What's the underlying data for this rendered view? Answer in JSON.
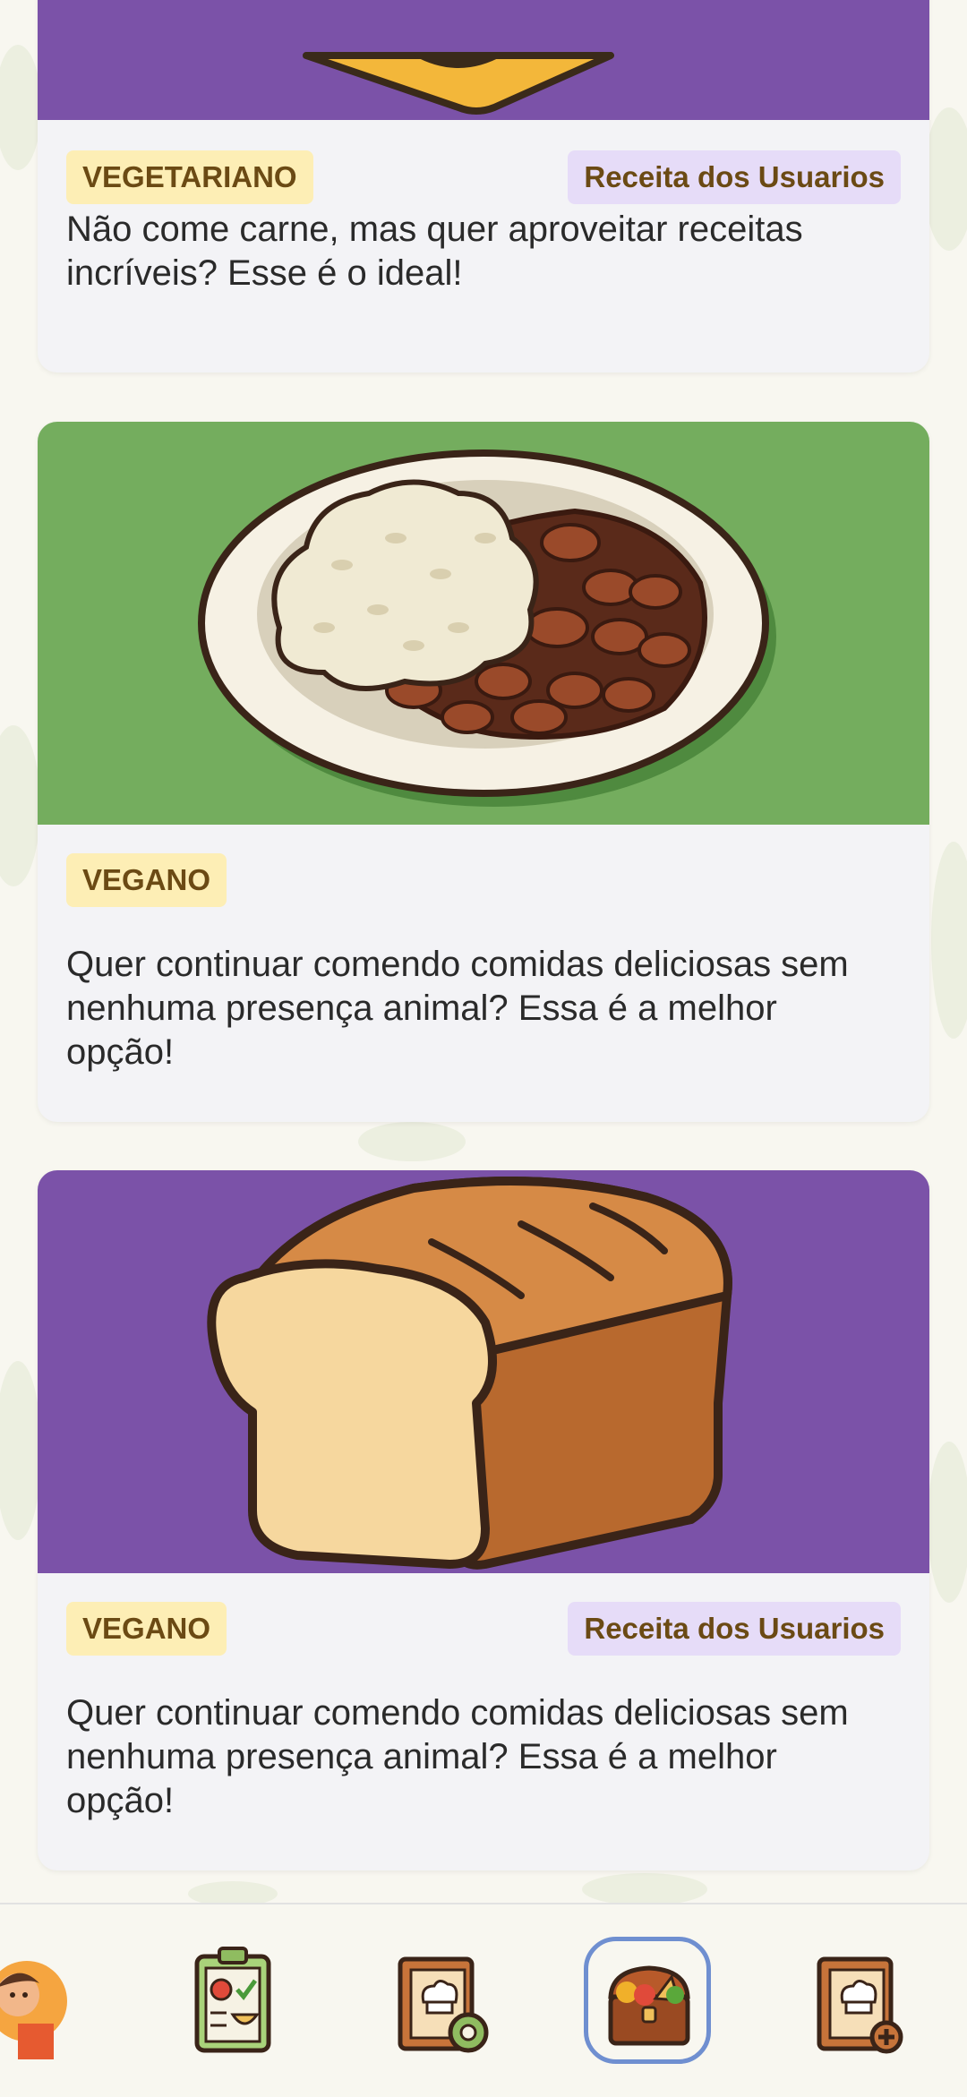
{
  "cards": [
    {
      "image": "vegetarian-dish-illustration",
      "diet_tag": "VEGETARIANO",
      "user_tag": "Receita dos Usuarios",
      "description": "Não come carne, mas quer aproveitar receitas incríveis? Esse é o ideal!"
    },
    {
      "image": "rice-and-beans-illustration",
      "diet_tag": "VEGANO",
      "description": "Quer continuar comendo comidas deliciosas sem nenhuma presença animal? Essa é a melhor opção!"
    },
    {
      "image": "bread-loaf-illustration",
      "diet_tag": "VEGANO",
      "user_tag": "Receita dos Usuarios",
      "description": "Quer continuar comendo comidas deliciosas sem nenhuma presença animal? Essa é a melhor opção!"
    }
  ],
  "nav": {
    "items": [
      {
        "icon": "profile-avatar-icon"
      },
      {
        "icon": "meal-plan-clipboard-icon"
      },
      {
        "icon": "recipe-book-settings-icon"
      },
      {
        "icon": "food-treasure-chest-icon",
        "active": true
      },
      {
        "icon": "add-recipe-book-icon"
      }
    ],
    "active_color": "#6f8fd0"
  },
  "colors": {
    "purple": "#7b52a8",
    "green": "#74ad5e",
    "tag_yellow": "#fdeeb5",
    "tag_lilac": "#e6dcf8"
  }
}
